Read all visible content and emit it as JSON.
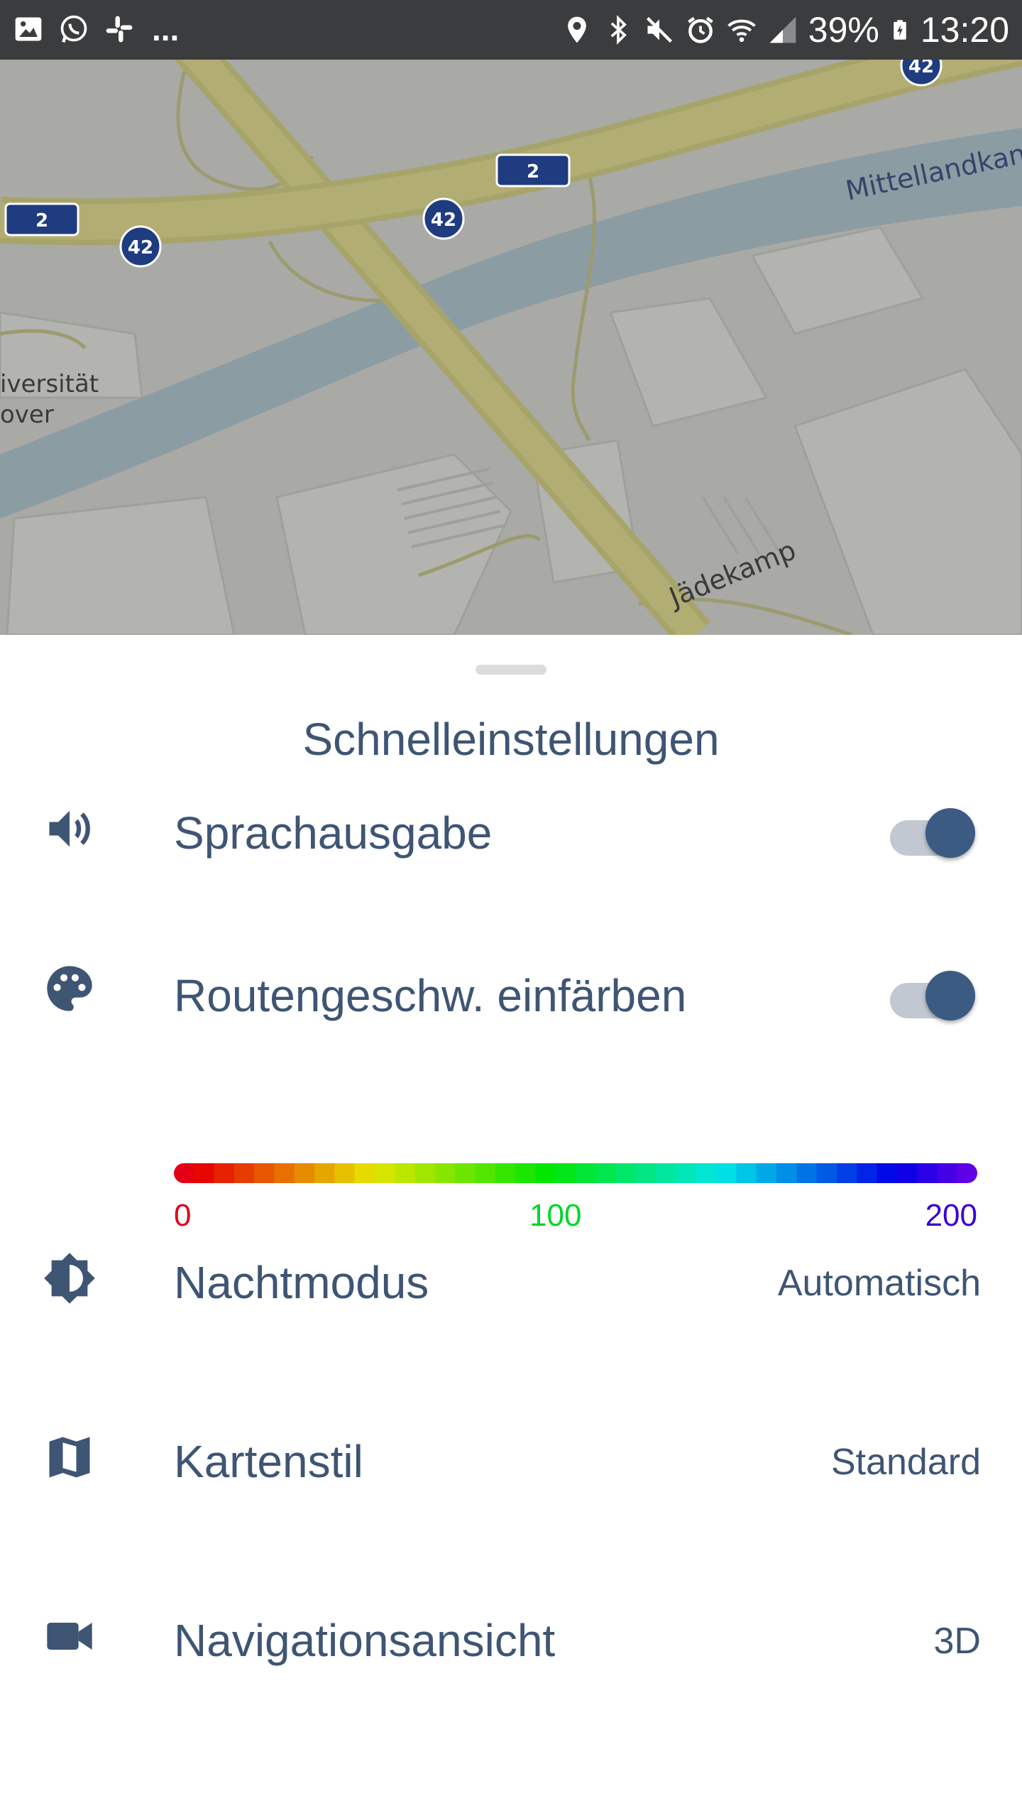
{
  "status_bar": {
    "notification_icons": [
      "gallery-icon",
      "whatsapp-icon",
      "slack-icon"
    ],
    "overflow": "...",
    "system_icons": [
      "location-icon",
      "bluetooth-icon",
      "mute-icon",
      "alarm-icon",
      "wifi-icon",
      "signal-icon"
    ],
    "battery_percent": "39%",
    "time": "13:20"
  },
  "map": {
    "labels": {
      "canal": "Mittellandkanal",
      "street": "Jädekamp",
      "university_line1": "iversität",
      "university_line2": "over"
    },
    "road_shields": {
      "a2": "2",
      "b42": "42"
    }
  },
  "sheet": {
    "title": "Schnelleinstellungen",
    "items": [
      {
        "id": "voice",
        "icon": "speaker-icon",
        "label": "Sprachausgabe",
        "toggle_on": true
      },
      {
        "id": "route-color",
        "icon": "palette-icon",
        "label": "Routengeschw. einfärben",
        "toggle_on": true
      },
      {
        "id": "night",
        "icon": "brightness-icon",
        "label": "Nachtmodus",
        "value": "Automatisch"
      },
      {
        "id": "map-style",
        "icon": "map-icon",
        "label": "Kartenstil",
        "value": "Standard"
      },
      {
        "id": "nav-view",
        "icon": "video-camera-icon",
        "label": "Navigationsansicht",
        "value": "3D"
      }
    ],
    "speed_scale": {
      "min": "0",
      "mid": "100",
      "max": "200",
      "colors": {
        "min": "#e0001b",
        "mid": "#00d626",
        "max": "#3a00d6"
      }
    }
  },
  "colors": {
    "accent": "#3c5b82",
    "text": "#3e5574"
  }
}
